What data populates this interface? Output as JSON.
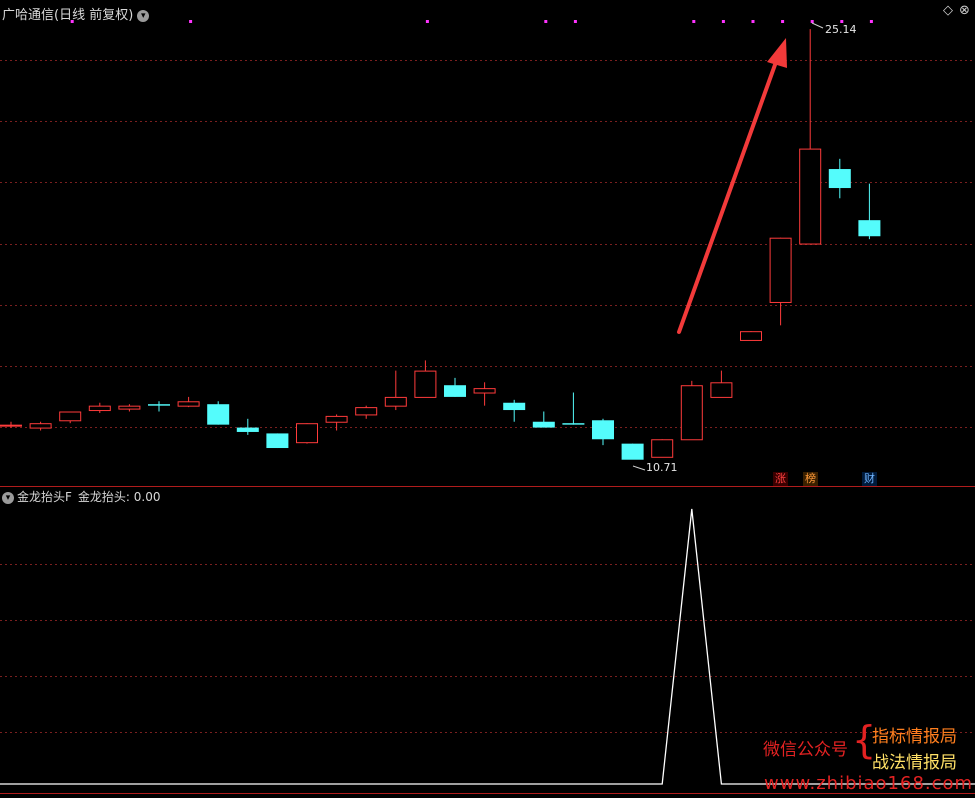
{
  "header": {
    "title": "广哈通信(日线 前复权)",
    "chevron": "chevron-down-icon",
    "diamond": "◇",
    "close": "⊗"
  },
  "indicator": {
    "name": "金龙抬头F",
    "value_label": "金龙抬头: 0.00"
  },
  "annotations": {
    "high_label": "25.14",
    "low_label": "10.71"
  },
  "badges": {
    "zhang": "涨",
    "bang": "榜",
    "cai": "财"
  },
  "watermark": {
    "left": "微信公众号",
    "brace": "{",
    "line1": "指标情报局",
    "line2": "战法情报局",
    "url": "www.zhibiao168.com"
  },
  "colors": {
    "up": "#ff3b3b",
    "down": "#54fcfc",
    "grid": "#7a1f1f",
    "signal": "#ff33ff",
    "arrow": "#f23a3a"
  },
  "chart_data": {
    "type": "candlestick",
    "price_range": [
      9.5,
      26.0
    ],
    "candles": [
      {
        "o": 11.6,
        "h": 11.7,
        "l": 11.5,
        "c": 11.6
      },
      {
        "o": 11.5,
        "h": 11.7,
        "l": 11.4,
        "c": 11.65
      },
      {
        "o": 11.75,
        "h": 12.0,
        "l": 11.65,
        "c": 12.05
      },
      {
        "o": 12.1,
        "h": 12.35,
        "l": 12.0,
        "c": 12.25
      },
      {
        "o": 12.15,
        "h": 12.3,
        "l": 12.05,
        "c": 12.25
      },
      {
        "o": 12.3,
        "h": 12.4,
        "l": 12.05,
        "c": 12.25
      },
      {
        "o": 12.25,
        "h": 12.55,
        "l": 12.2,
        "c": 12.4
      },
      {
        "o": 12.3,
        "h": 12.4,
        "l": 11.6,
        "c": 11.6
      },
      {
        "o": 11.5,
        "h": 11.8,
        "l": 11.25,
        "c": 11.35
      },
      {
        "o": 11.3,
        "h": 11.3,
        "l": 10.8,
        "c": 10.8
      },
      {
        "o": 11.0,
        "h": 11.65,
        "l": 10.95,
        "c": 11.65
      },
      {
        "o": 11.7,
        "h": 11.95,
        "l": 11.4,
        "c": 11.9
      },
      {
        "o": 11.95,
        "h": 12.25,
        "l": 11.8,
        "c": 12.2
      },
      {
        "o": 12.25,
        "h": 13.45,
        "l": 12.1,
        "c": 12.55
      },
      {
        "o": 12.55,
        "h": 13.8,
        "l": 12.55,
        "c": 13.45
      },
      {
        "o": 12.95,
        "h": 13.2,
        "l": 12.55,
        "c": 12.55
      },
      {
        "o": 12.7,
        "h": 13.05,
        "l": 12.25,
        "c": 12.85
      },
      {
        "o": 12.35,
        "h": 12.45,
        "l": 11.7,
        "c": 12.1
      },
      {
        "o": 11.7,
        "h": 12.05,
        "l": 11.5,
        "c": 11.5
      },
      {
        "o": 11.65,
        "h": 12.7,
        "l": 11.6,
        "c": 11.6
      },
      {
        "o": 11.75,
        "h": 11.8,
        "l": 10.9,
        "c": 11.1
      },
      {
        "o": 10.95,
        "h": 10.95,
        "l": 10.71,
        "c": 10.4
      },
      {
        "o": 10.5,
        "h": 11.1,
        "l": 10.5,
        "c": 11.1
      },
      {
        "o": 11.1,
        "h": 13.1,
        "l": 11.1,
        "c": 12.95
      },
      {
        "o": 12.55,
        "h": 13.45,
        "l": 12.55,
        "c": 13.05
      },
      {
        "o": 14.5,
        "h": 14.8,
        "l": 14.5,
        "c": 14.8
      },
      {
        "o": 15.8,
        "h": 18.0,
        "l": 15.0,
        "c": 18.0
      },
      {
        "o": 17.8,
        "h": 25.14,
        "l": 17.8,
        "c": 21.05
      },
      {
        "o": 20.35,
        "h": 20.7,
        "l": 19.35,
        "c": 19.7
      },
      {
        "o": 18.6,
        "h": 19.85,
        "l": 17.95,
        "c": 18.05
      }
    ],
    "indicator_values": [
      0,
      0,
      0,
      0,
      0,
      0,
      0,
      0,
      0,
      0,
      0,
      0,
      0,
      0,
      0,
      0,
      0,
      0,
      0,
      0,
      0,
      0,
      0,
      1,
      0,
      0,
      0,
      0,
      0,
      0
    ],
    "signal_dot_indices": [
      2,
      6,
      14,
      18,
      19,
      23,
      24,
      25,
      26,
      27,
      28,
      29
    ]
  }
}
